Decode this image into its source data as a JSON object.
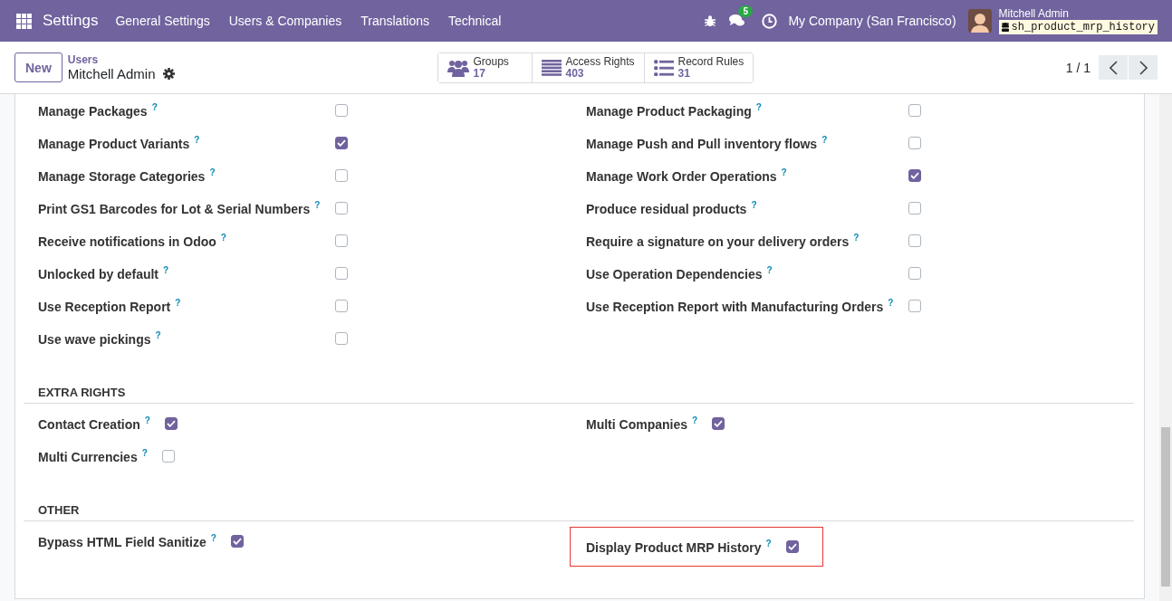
{
  "navbar": {
    "app": "Settings",
    "menu": [
      "General Settings",
      "Users & Companies",
      "Translations",
      "Technical"
    ],
    "chat_badge": "5",
    "company": "My Company (San Francisco)",
    "user": "Mitchell Admin",
    "database": "sh_product_mrp_history"
  },
  "control_panel": {
    "new_button": "New",
    "breadcrumb": "Users",
    "record": "Mitchell Admin",
    "stat_buttons": [
      {
        "kind": "groups",
        "label": "Groups",
        "value": "17"
      },
      {
        "kind": "rights",
        "label": "Access Rights",
        "value": "403"
      },
      {
        "kind": "rules",
        "label": "Record Rules",
        "value": "31"
      }
    ],
    "pager": "1 / 1"
  },
  "sections": [
    {
      "kind": "table",
      "columns": [
        [
          {
            "label": "Manage Packages",
            "help": "?",
            "checked": false,
            "highlighted": false
          },
          {
            "label": "Manage Product Variants",
            "help": "?",
            "checked": true,
            "highlighted": false
          },
          {
            "label": "Manage Storage Categories",
            "help": "?",
            "checked": false,
            "highlighted": false
          },
          {
            "label": "Print GS1 Barcodes for Lot & Serial Numbers",
            "help": "?",
            "checked": false,
            "highlighted": false
          },
          {
            "label": "Receive notifications in Odoo",
            "help": "?",
            "checked": false,
            "highlighted": false
          },
          {
            "label": "Unlocked by default",
            "help": "?",
            "checked": false,
            "highlighted": false
          },
          {
            "label": "Use Reception Report",
            "help": "?",
            "checked": false,
            "highlighted": false
          },
          {
            "label": "Use wave pickings",
            "help": "?",
            "checked": false,
            "highlighted": false
          }
        ],
        [
          {
            "label": "Manage Product Packaging",
            "help": "?",
            "checked": false,
            "highlighted": false
          },
          {
            "label": "Manage Push and Pull inventory flows",
            "help": "?",
            "checked": false,
            "highlighted": false
          },
          {
            "label": "Manage Work Order Operations",
            "help": "?",
            "checked": true,
            "highlighted": false
          },
          {
            "label": "Produce residual products",
            "help": "?",
            "checked": false,
            "highlighted": false
          },
          {
            "label": "Require a signature on your delivery orders",
            "help": "?",
            "checked": false,
            "highlighted": false
          },
          {
            "label": "Use Operation Dependencies",
            "help": "?",
            "checked": false,
            "highlighted": false
          },
          {
            "label": "Use Reception Report with Manufacturing Orders",
            "help": "?",
            "checked": false,
            "highlighted": false
          }
        ]
      ]
    },
    {
      "kind": "inline",
      "title": "EXTRA RIGHTS",
      "columns": [
        [
          {
            "label": "Contact Creation",
            "help": "?",
            "checked": true,
            "highlighted": false
          },
          {
            "label": "Multi Currencies",
            "help": "?",
            "checked": false,
            "highlighted": false
          }
        ],
        [
          {
            "label": "Multi Companies",
            "help": "?",
            "checked": true,
            "highlighted": false
          }
        ]
      ]
    },
    {
      "kind": "inline",
      "title": "OTHER",
      "columns": [
        [
          {
            "label": "Bypass HTML Field Sanitize",
            "help": "?",
            "checked": true,
            "highlighted": false
          }
        ],
        [
          {
            "label": "Display Product MRP History",
            "help": "?",
            "checked": true,
            "highlighted": true
          }
        ]
      ]
    }
  ]
}
